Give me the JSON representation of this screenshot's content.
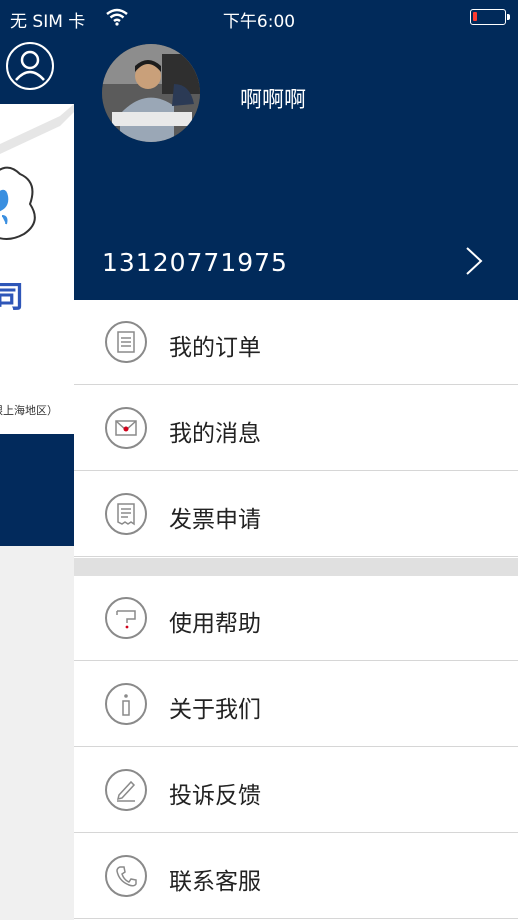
{
  "status_bar": {
    "carrier": "无 SIM 卡",
    "time": "下午6:00"
  },
  "background_page": {
    "company_text": "司",
    "note_text": "限上海地区）"
  },
  "drawer": {
    "username": "啊啊啊",
    "phone": "13120771975",
    "menu_group_1": [
      {
        "label": "我的订单",
        "icon": "order-icon"
      },
      {
        "label": "我的消息",
        "icon": "message-icon"
      },
      {
        "label": "发票申请",
        "icon": "invoice-icon"
      }
    ],
    "menu_group_2": [
      {
        "label": "使用帮助",
        "icon": "help-icon"
      },
      {
        "label": "关于我们",
        "icon": "info-icon"
      },
      {
        "label": "投诉反馈",
        "icon": "feedback-icon"
      },
      {
        "label": "联系客服",
        "icon": "phone-icon"
      }
    ],
    "colors": {
      "header_bg": "#012a5a",
      "accent_red": "#d0021b"
    }
  }
}
